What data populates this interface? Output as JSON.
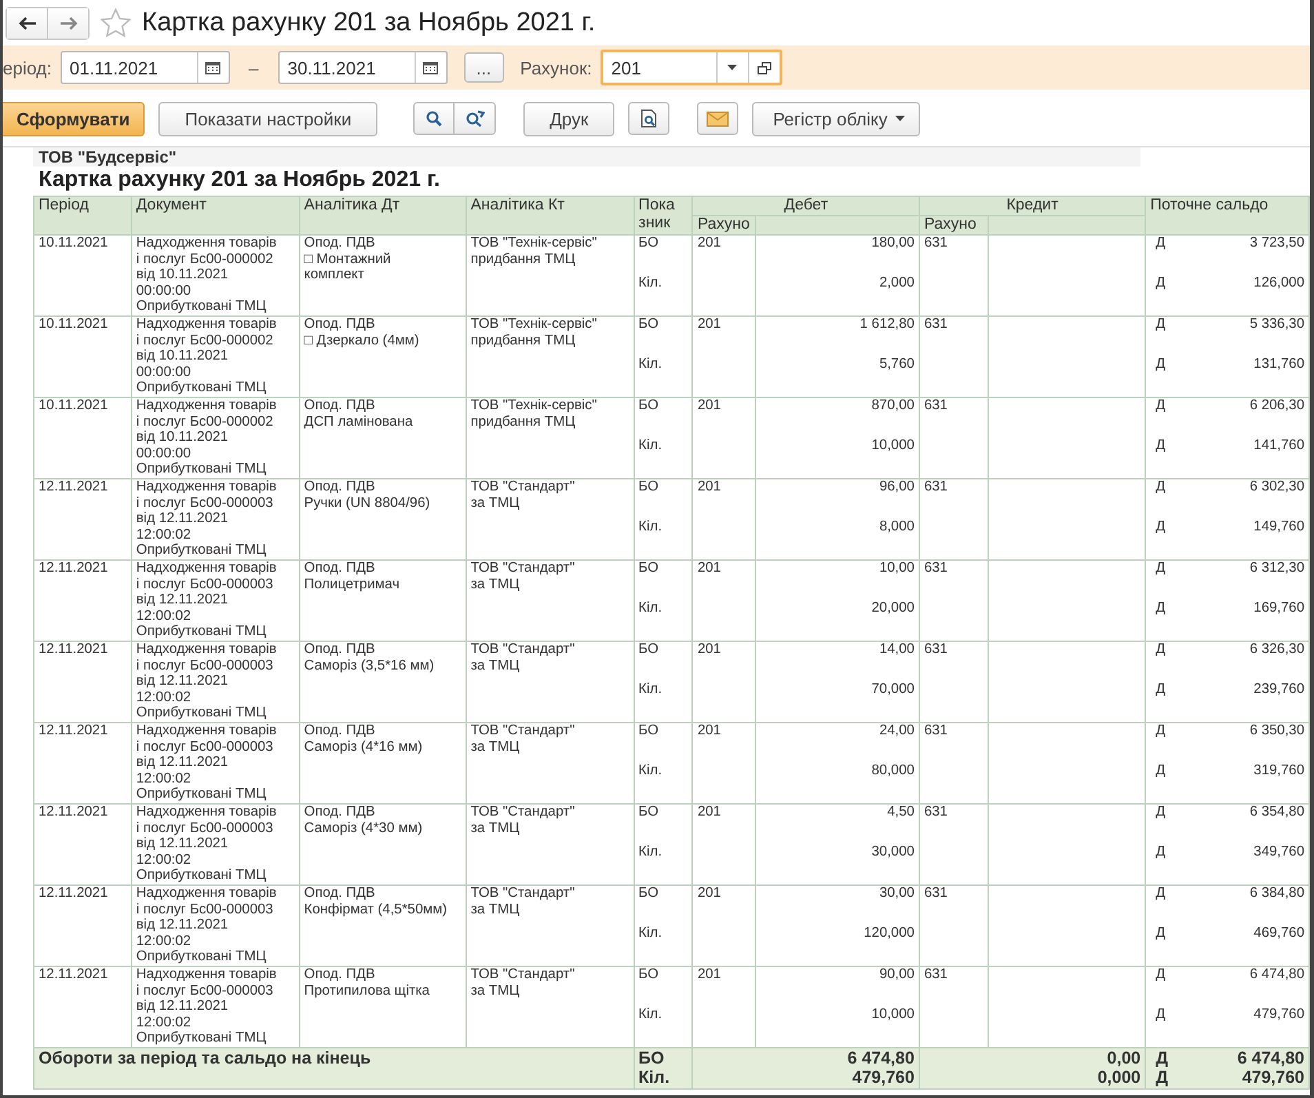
{
  "window": {
    "title": "Картка рахунку 201 за Ноябрь 2021 г."
  },
  "filter": {
    "period_label": "еріод:",
    "date_from": "01.11.2021",
    "dash": "–",
    "date_to": "30.11.2021",
    "more_button": "...",
    "account_label": "Рахунок:",
    "account": "201"
  },
  "toolbar": {
    "generate": "Сформувати",
    "settings": "Показати настройки",
    "print": "Друк",
    "register": "Регістр обліку"
  },
  "report": {
    "company": "ТОВ \"Будсервіс\"",
    "title": "Картка рахунку 201 за Ноябрь 2021 г.",
    "columns": {
      "period": "Період",
      "document": "Документ",
      "analytics_dt": "Аналітика Дт",
      "analytics_kt": "Аналітика Кт",
      "indicator": [
        "Пока",
        "зник"
      ],
      "debit": "Дебет",
      "credit": "Кредит",
      "balance": "Поточне сальдо",
      "debit_account": "Рахуно",
      "credit_account": "Рахуно"
    },
    "rows": [
      {
        "period": "10.11.2021",
        "document": [
          "Надходження товарів",
          "і послуг Бс00-000002",
          "від 10.11.2021",
          "00:00:00",
          "Оприбутковані ТМЦ"
        ],
        "analytics_dt": [
          "Опод. ПДВ",
          "□  Монтажний",
          "комплект"
        ],
        "analytics_kt": [
          "ТОВ \"Технік-сервіс\"",
          "придбання ТМЦ"
        ],
        "ind_sum": "БО",
        "ind_qty": "Кіл.",
        "debit_account": "201",
        "debit_sum": "180,00",
        "debit_qty": "2,000",
        "credit_account": "631",
        "sign_sum": "Д",
        "balance_sum": "3 723,50",
        "sign_qty": "Д",
        "balance_qty": "126,000"
      },
      {
        "period": "10.11.2021",
        "document": [
          "Надходження товарів",
          "і послуг Бс00-000002",
          "від 10.11.2021",
          "00:00:00",
          "Оприбутковані ТМЦ"
        ],
        "analytics_dt": [
          "Опод. ПДВ",
          "□  Дзеркало (4мм)"
        ],
        "analytics_kt": [
          "ТОВ \"Технік-сервіс\"",
          "придбання ТМЦ"
        ],
        "ind_sum": "БО",
        "ind_qty": "Кіл.",
        "debit_account": "201",
        "debit_sum": "1 612,80",
        "debit_qty": "5,760",
        "credit_account": "631",
        "sign_sum": "Д",
        "balance_sum": "5 336,30",
        "sign_qty": "Д",
        "balance_qty": "131,760"
      },
      {
        "period": "10.11.2021",
        "document": [
          "Надходження товарів",
          "і послуг Бс00-000002",
          "від 10.11.2021",
          "00:00:00",
          "Оприбутковані ТМЦ"
        ],
        "analytics_dt": [
          "Опод. ПДВ",
          "ДСП ламінована"
        ],
        "analytics_kt": [
          "ТОВ \"Технік-сервіс\"",
          "придбання ТМЦ"
        ],
        "ind_sum": "БО",
        "ind_qty": "Кіл.",
        "debit_account": "201",
        "debit_sum": "870,00",
        "debit_qty": "10,000",
        "credit_account": "631",
        "sign_sum": "Д",
        "balance_sum": "6 206,30",
        "sign_qty": "Д",
        "balance_qty": "141,760"
      },
      {
        "period": "12.11.2021",
        "document": [
          "Надходження товарів",
          "і послуг Бс00-000003",
          "від 12.11.2021",
          "12:00:02",
          "Оприбутковані ТМЦ"
        ],
        "analytics_dt": [
          "Опод. ПДВ",
          "Ручки (UN 8804/96)"
        ],
        "analytics_kt": [
          "ТОВ \"Стандарт\"",
          "за ТМЦ"
        ],
        "ind_sum": "БО",
        "ind_qty": "Кіл.",
        "debit_account": "201",
        "debit_sum": "96,00",
        "debit_qty": "8,000",
        "credit_account": "631",
        "sign_sum": "Д",
        "balance_sum": "6 302,30",
        "sign_qty": "Д",
        "balance_qty": "149,760"
      },
      {
        "period": "12.11.2021",
        "document": [
          "Надходження товарів",
          "і послуг Бс00-000003",
          "від 12.11.2021",
          "12:00:02",
          "Оприбутковані ТМЦ"
        ],
        "analytics_dt": [
          "Опод. ПДВ",
          "Полицетримач"
        ],
        "analytics_kt": [
          "ТОВ \"Стандарт\"",
          "за ТМЦ"
        ],
        "ind_sum": "БО",
        "ind_qty": "Кіл.",
        "debit_account": "201",
        "debit_sum": "10,00",
        "debit_qty": "20,000",
        "credit_account": "631",
        "sign_sum": "Д",
        "balance_sum": "6 312,30",
        "sign_qty": "Д",
        "balance_qty": "169,760"
      },
      {
        "period": "12.11.2021",
        "document": [
          "Надходження товарів",
          "і послуг Бс00-000003",
          "від 12.11.2021",
          "12:00:02",
          "Оприбутковані ТМЦ"
        ],
        "analytics_dt": [
          "Опод. ПДВ",
          "Саморіз (3,5*16 мм)"
        ],
        "analytics_kt": [
          "ТОВ \"Стандарт\"",
          "за ТМЦ"
        ],
        "ind_sum": "БО",
        "ind_qty": "Кіл.",
        "debit_account": "201",
        "debit_sum": "14,00",
        "debit_qty": "70,000",
        "credit_account": "631",
        "sign_sum": "Д",
        "balance_sum": "6 326,30",
        "sign_qty": "Д",
        "balance_qty": "239,760"
      },
      {
        "period": "12.11.2021",
        "document": [
          "Надходження товарів",
          "і послуг Бс00-000003",
          "від 12.11.2021",
          "12:00:02",
          "Оприбутковані ТМЦ"
        ],
        "analytics_dt": [
          "Опод. ПДВ",
          "Саморіз (4*16 мм)"
        ],
        "analytics_kt": [
          "ТОВ \"Стандарт\"",
          "за ТМЦ"
        ],
        "ind_sum": "БО",
        "ind_qty": "Кіл.",
        "debit_account": "201",
        "debit_sum": "24,00",
        "debit_qty": "80,000",
        "credit_account": "631",
        "sign_sum": "Д",
        "balance_sum": "6 350,30",
        "sign_qty": "Д",
        "balance_qty": "319,760"
      },
      {
        "period": "12.11.2021",
        "document": [
          "Надходження товарів",
          "і послуг Бс00-000003",
          "від 12.11.2021",
          "12:00:02",
          "Оприбутковані ТМЦ"
        ],
        "analytics_dt": [
          "Опод. ПДВ",
          "Саморіз (4*30 мм)"
        ],
        "analytics_kt": [
          "ТОВ \"Стандарт\"",
          "за ТМЦ"
        ],
        "ind_sum": "БО",
        "ind_qty": "Кіл.",
        "debit_account": "201",
        "debit_sum": "4,50",
        "debit_qty": "30,000",
        "credit_account": "631",
        "sign_sum": "Д",
        "balance_sum": "6 354,80",
        "sign_qty": "Д",
        "balance_qty": "349,760"
      },
      {
        "period": "12.11.2021",
        "document": [
          "Надходження товарів",
          "і послуг Бс00-000003",
          "від 12.11.2021",
          "12:00:02",
          "Оприбутковані ТМЦ"
        ],
        "analytics_dt": [
          "Опод. ПДВ",
          "Конфірмат (4,5*50мм)"
        ],
        "analytics_kt": [
          "ТОВ \"Стандарт\"",
          "за ТМЦ"
        ],
        "ind_sum": "БО",
        "ind_qty": "Кіл.",
        "debit_account": "201",
        "debit_sum": "30,00",
        "debit_qty": "120,000",
        "credit_account": "631",
        "sign_sum": "Д",
        "balance_sum": "6 384,80",
        "sign_qty": "Д",
        "balance_qty": "469,760"
      },
      {
        "period": "12.11.2021",
        "document": [
          "Надходження товарів",
          "і послуг Бс00-000003",
          "від 12.11.2021",
          "12:00:02",
          "Оприбутковані ТМЦ"
        ],
        "analytics_dt": [
          "Опод. ПДВ",
          "Протипилова щітка"
        ],
        "analytics_kt": [
          "ТОВ \"Стандарт\"",
          "за ТМЦ"
        ],
        "ind_sum": "БО",
        "ind_qty": "Кіл.",
        "debit_account": "201",
        "debit_sum": "90,00",
        "debit_qty": "10,000",
        "credit_account": "631",
        "sign_sum": "Д",
        "balance_sum": "6 474,80",
        "sign_qty": "Д",
        "balance_qty": "479,760"
      }
    ],
    "totals": {
      "label": "Обороти за період та сальдо на кінець",
      "ind_sum": "БО",
      "ind_qty": "Кіл.",
      "debit_sum": "6 474,80",
      "debit_qty": "479,760",
      "credit_sum": "0,00",
      "credit_qty": "0,000",
      "sign_sum": "Д",
      "balance_sum": "6 474,80",
      "sign_qty": "Д",
      "balance_qty": "479,760"
    }
  }
}
